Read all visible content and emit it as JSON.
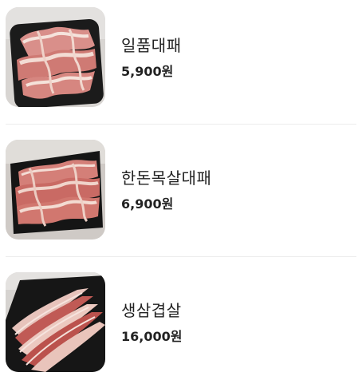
{
  "menu": {
    "items": [
      {
        "name": "일품대패",
        "price": "5,900원",
        "image": "thinly-sliced-pork-belly-on-black-plate"
      },
      {
        "name": "한돈목살대패",
        "price": "6,900원",
        "image": "thinly-sliced-pork-neck-on-black-plate"
      },
      {
        "name": "생삼겹살",
        "price": "16,000원",
        "image": "fresh-pork-belly-strips-on-black-plate"
      }
    ]
  },
  "colors": {
    "text": "#222222",
    "divider": "#ececec",
    "plate": "#1a1a1a",
    "meat_red": "#c96a66",
    "meat_fat": "#f2ddd6"
  }
}
